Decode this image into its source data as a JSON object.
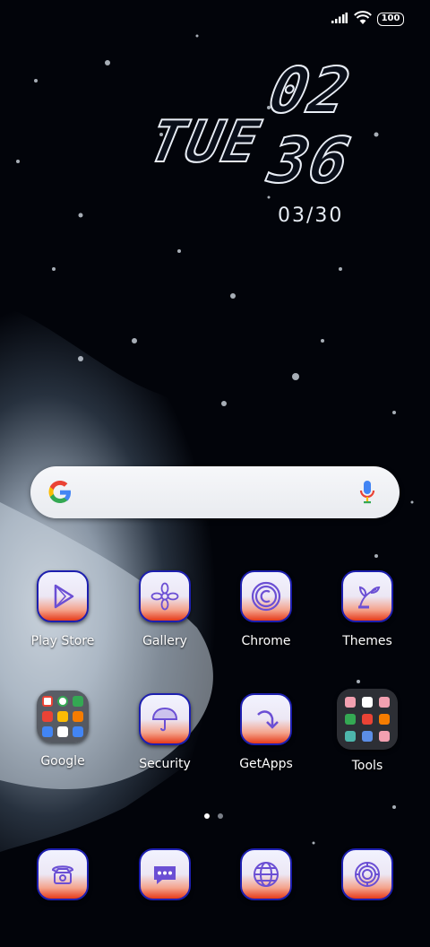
{
  "status_bar": {
    "battery": "100"
  },
  "clock": {
    "weekday": "TUE",
    "hour": "02",
    "minute": "36",
    "date": "03/30"
  },
  "apps_row1": [
    {
      "label": "Play Store",
      "icon": "play-store-icon"
    },
    {
      "label": "Gallery",
      "icon": "gallery-flower-icon"
    },
    {
      "label": "Chrome",
      "icon": "chrome-icon"
    },
    {
      "label": "Themes",
      "icon": "themes-icon"
    }
  ],
  "apps_row2": [
    {
      "label": "Google",
      "icon": "google-folder-icon"
    },
    {
      "label": "Security",
      "icon": "security-umbrella-icon"
    },
    {
      "label": "GetApps",
      "icon": "getapps-icon"
    },
    {
      "label": "Tools",
      "icon": "tools-folder-icon"
    }
  ],
  "dock": [
    {
      "icon": "phone-icon"
    },
    {
      "icon": "messages-icon"
    },
    {
      "icon": "browser-globe-icon"
    },
    {
      "icon": "camera-icon"
    }
  ],
  "colors": {
    "icon_border": "#1d1faf",
    "icon_bottom": "#e63b1a",
    "google_blue": "#4285F4",
    "google_red": "#EA4335",
    "google_yellow": "#FBBC05",
    "google_green": "#34A853"
  }
}
